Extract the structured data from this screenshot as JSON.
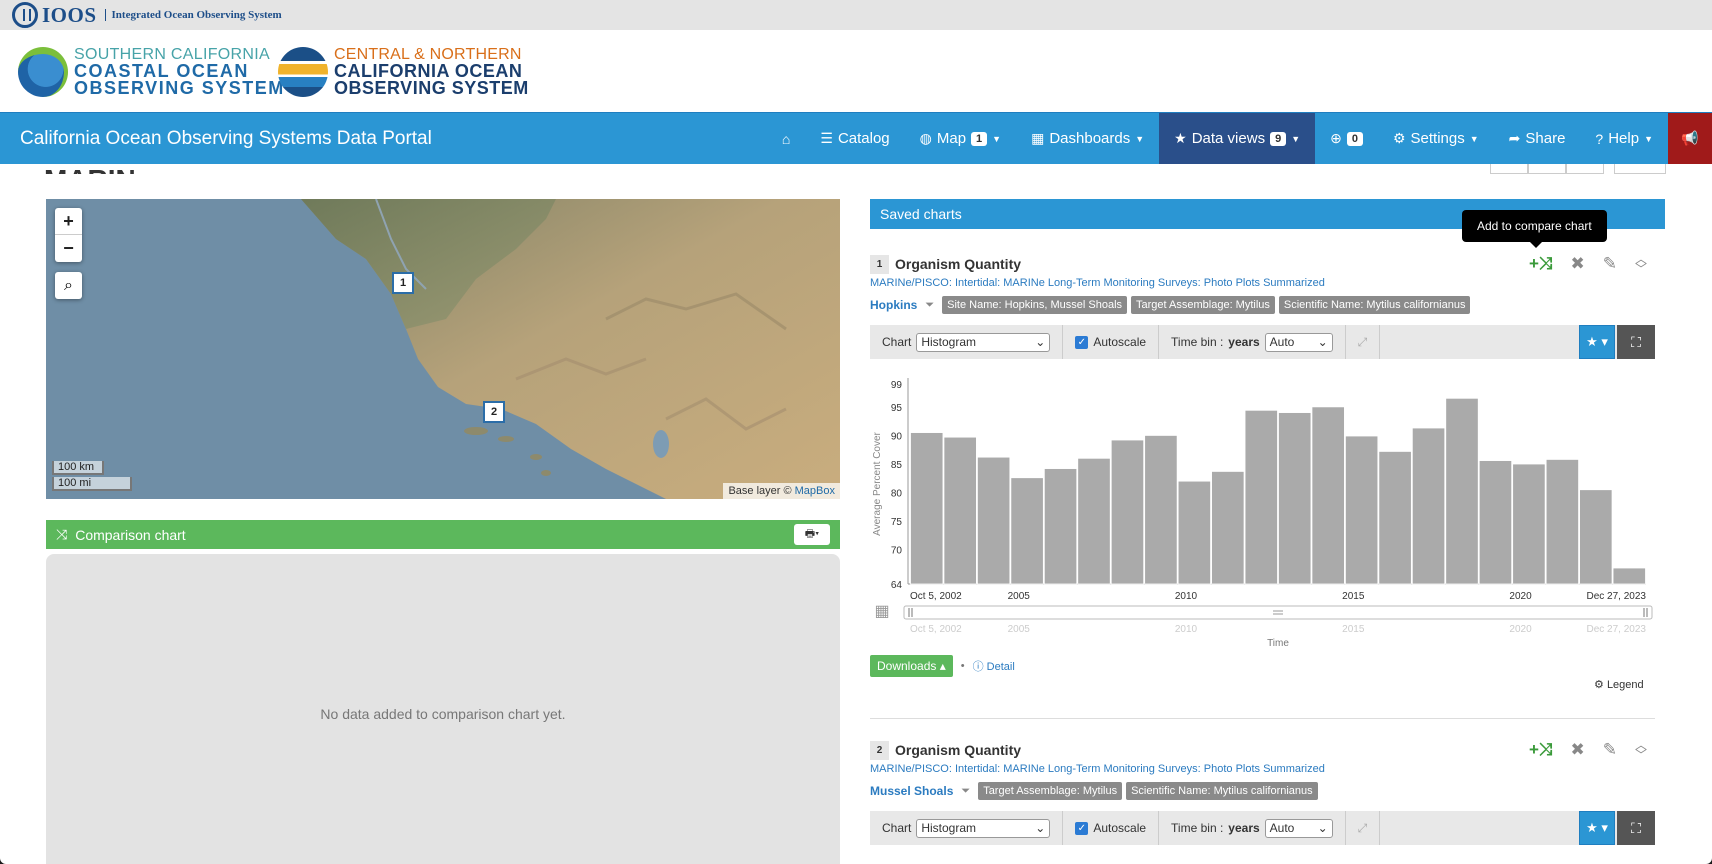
{
  "ioos": {
    "name": "IOOS",
    "subtitle": "Integrated Ocean Observing System"
  },
  "logos": {
    "sccoos": {
      "line1": "SOUTHERN CALIFORNIA",
      "line2": "COASTAL OCEAN",
      "line3": "OBSERVING SYSTEM"
    },
    "cencoos": {
      "line1": "CENTRAL & NORTHERN",
      "line2": "CALIFORNIA OCEAN",
      "line3": "OBSERVING SYSTEM"
    }
  },
  "navbar": {
    "title": "California Ocean Observing Systems Data Portal",
    "home_icon": "home-icon",
    "catalog": "Catalog",
    "map": "Map",
    "map_badge": "1",
    "dashboards": "Dashboards",
    "data_views": "Data views",
    "data_views_badge": "9",
    "downloads_badge": "0",
    "settings": "Settings",
    "share": "Share",
    "help": "Help"
  },
  "page": {
    "title": "MARINe"
  },
  "map": {
    "zoom_in": "+",
    "zoom_out": "−",
    "markers": [
      "1",
      "2"
    ],
    "scale_km": "100 km",
    "scale_mi": "100 mi",
    "attribution_prefix": "Base layer ©",
    "attribution_link": "MapBox"
  },
  "comparison": {
    "title": "Comparison chart",
    "empty": "No data added to comparison chart yet."
  },
  "saved": {
    "title": "Saved charts",
    "tooltip": "Add to compare chart",
    "charts": [
      {
        "number": "1",
        "name": "Organism Quantity",
        "source": "MARINe/PISCO: Intertidal: MARINe Long-Term Monitoring Surveys: Photo Plots Summarized",
        "location": "Hopkins",
        "tags": [
          "Site Name: Hopkins, Mussel Shoals",
          "Target Assemblage: Mytilus",
          "Scientific Name: Mytilus californianus"
        ]
      },
      {
        "number": "2",
        "name": "Organism Quantity",
        "source": "MARINe/PISCO: Intertidal: MARINe Long-Term Monitoring Surveys: Photo Plots Summarized",
        "location": "Mussel Shoals",
        "tags": [
          "Target Assemblage: Mytilus",
          "Scientific Name: Mytilus californianus"
        ]
      }
    ]
  },
  "toolbar": {
    "chart_label": "Chart",
    "chart_type": "Histogram",
    "autoscale": "Autoscale",
    "time_bin_label": "Time bin :",
    "time_bin_unit": "years",
    "time_bin_value": "Auto"
  },
  "actions": {
    "downloads": "Downloads",
    "detail": "Detail",
    "legend": "Legend"
  },
  "chart_data": {
    "type": "bar",
    "ylabel": "Average Percent Cover",
    "xlabel": "Time",
    "ylim": [
      64,
      99
    ],
    "yticks": [
      64,
      70,
      75,
      80,
      85,
      90,
      95,
      99
    ],
    "x_start_label": "Oct 5, 2002",
    "x_end_label": "Dec 27, 2023",
    "xticks": [
      "2005",
      "2010",
      "2015",
      "2020"
    ],
    "categories": [
      "2002",
      "2003",
      "2004",
      "2005",
      "2006",
      "2007",
      "2008",
      "2009",
      "2010",
      "2011",
      "2012",
      "2013",
      "2014",
      "2015",
      "2016",
      "2017",
      "2018",
      "2019",
      "2020",
      "2021",
      "2022",
      "2023"
    ],
    "values": [
      90.5,
      89.7,
      86.2,
      82.6,
      84.2,
      86.0,
      89.2,
      90.0,
      82.0,
      83.7,
      94.4,
      94.0,
      95.0,
      89.9,
      87.2,
      91.3,
      96.5,
      85.6,
      85.0,
      85.8,
      80.5,
      66.8
    ],
    "color": "#aaaaaa"
  }
}
